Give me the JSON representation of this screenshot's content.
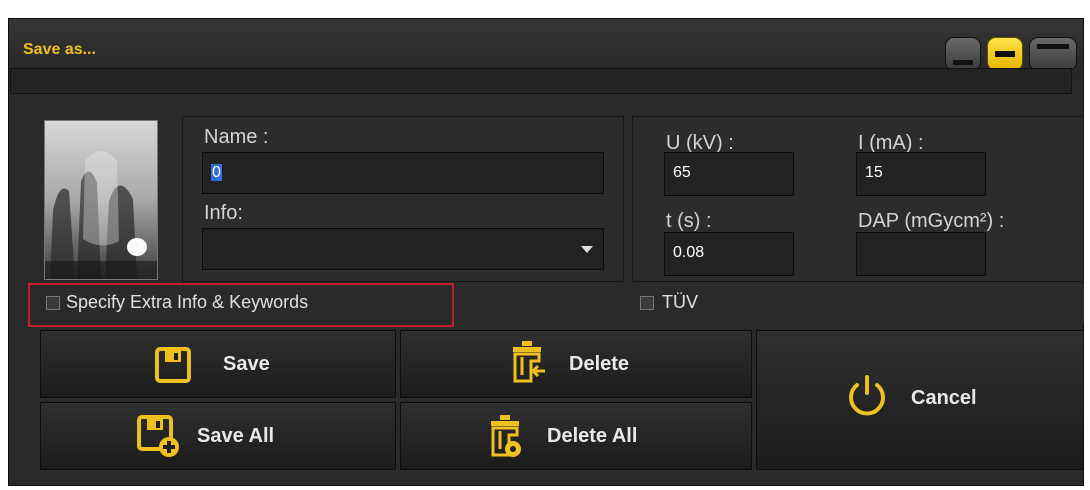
{
  "window": {
    "title": "Save as..."
  },
  "form": {
    "name_label": "Name :",
    "name_value": "0",
    "info_label": "Info:",
    "info_value": "",
    "voltage_label": "U (kV) :",
    "voltage_value": "65",
    "current_label": "I (mA) :",
    "current_value": "15",
    "time_label": "t (s) :",
    "time_value": "0.08",
    "dap_label": "DAP (mGycm²) :",
    "dap_value": ""
  },
  "options": {
    "extra_info_label": "Specify Extra Info & Keywords",
    "extra_info_checked": false,
    "tuv_label": "TÜV",
    "tuv_checked": false
  },
  "buttons": {
    "save": "Save",
    "save_all": "Save All",
    "delete": "Delete",
    "delete_all": "Delete All",
    "cancel": "Cancel"
  },
  "colors": {
    "accent": "#f0c020",
    "highlight": "#c1202c"
  }
}
